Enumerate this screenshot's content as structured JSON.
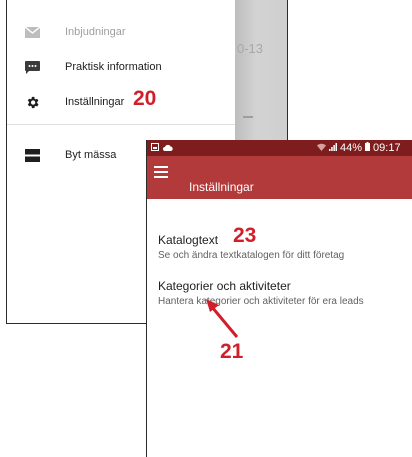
{
  "drawer": {
    "items": [
      {
        "label": "Inbjudningar",
        "icon": "envelope-icon",
        "enabled": false
      },
      {
        "label": "Praktisk information",
        "icon": "message-icon",
        "enabled": true
      },
      {
        "label": "Inställningar",
        "icon": "gear-icon",
        "enabled": true
      },
      {
        "label": "Byt mässa",
        "icon": "switch-icon",
        "enabled": true
      }
    ],
    "background_date_fragment": "0-13"
  },
  "annotations": {
    "a20": "20",
    "a23": "23",
    "a21": "21",
    "color": "#d01f2a"
  },
  "status_bar": {
    "battery": "44%",
    "time": "09:17"
  },
  "app_bar": {
    "title": "Inställningar",
    "color": "#b23a3a"
  },
  "settings": [
    {
      "title": "Katalogtext",
      "subtitle": "Se och ändra textkatalogen för ditt företag"
    },
    {
      "title": "Kategorier och aktiviteter",
      "subtitle": "Hantera kategorier och aktiviteter för era leads"
    }
  ]
}
